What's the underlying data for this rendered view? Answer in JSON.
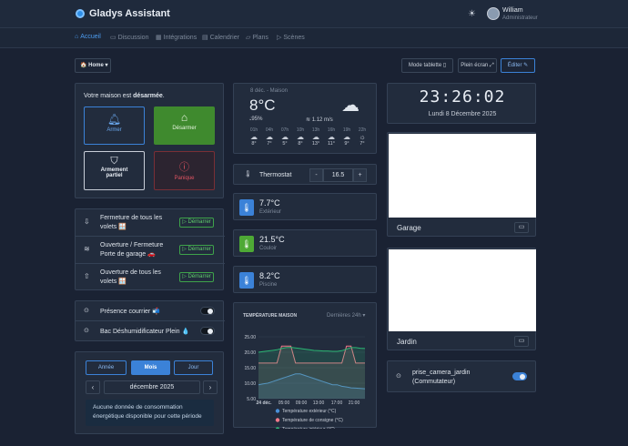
{
  "app": {
    "title": "Gladys Assistant"
  },
  "user": {
    "name": "William",
    "role": "Administrateur"
  },
  "nav": [
    {
      "icon": "home-icon",
      "label": "Accueil"
    },
    {
      "icon": "chat-icon",
      "label": "Discussion"
    },
    {
      "icon": "grid-icon",
      "label": "Intégrations"
    },
    {
      "icon": "calendar-icon",
      "label": "Calendrier"
    },
    {
      "icon": "map-icon",
      "label": "Plans"
    },
    {
      "icon": "play-icon",
      "label": "Scènes"
    }
  ],
  "toolbar": {
    "home_select": "Home",
    "tablet_mode": "Mode tablette",
    "fullscreen": "Plein écran",
    "edit": "Éditer"
  },
  "alarm": {
    "status_prefix": "Votre maison est",
    "status_value": "désarmée",
    "arm": "Armer",
    "disarm": "Désarmer",
    "partial_line1": "Armement",
    "partial_line2": "partiel",
    "panic": "Panique"
  },
  "scenes": [
    {
      "line1": "Fermeture de tous les",
      "line2": "volets 🪟",
      "button": "Démarrer"
    },
    {
      "line1": "Ouverture / Fermeture",
      "line2": "Porte de garage 🚗",
      "button": "Démarrer"
    },
    {
      "line1": "Ouverture de tous les",
      "line2": "volets 🪟",
      "button": "Démarrer"
    }
  ],
  "switches": [
    {
      "label": "Présence courrier 📬",
      "on": false
    },
    {
      "label": "Bac Déshumidificateur Plein 💧",
      "on": false
    }
  ],
  "energy": {
    "tabs": [
      "Année",
      "Mois",
      "Jour"
    ],
    "active_tab": "Mois",
    "period": "décembre 2025",
    "message": "Aucune donnée de consommation énergétique disponible pour cette période"
  },
  "weather": {
    "header": "8 déc. - Maison",
    "temp": "8°C",
    "humidity": "95%",
    "wind": "1.12 m/s",
    "hours": [
      "01h",
      "04h",
      "07h",
      "10h",
      "13h",
      "16h",
      "19h",
      "22h"
    ],
    "hour_temps": [
      "8°",
      "7°",
      "5°",
      "8°",
      "13°",
      "11°",
      "9°",
      "7°"
    ]
  },
  "thermostat": {
    "label": "Thermostat",
    "value": "16.5",
    "minus": "-",
    "plus": "+"
  },
  "sensors": [
    {
      "value": "7.7°C",
      "name": "Extérieur",
      "color": "#3b82d8"
    },
    {
      "value": "21.5°C",
      "name": "Couloir",
      "color": "#4ea935"
    },
    {
      "value": "8.2°C",
      "name": "Piscine",
      "color": "#3b82d8"
    }
  ],
  "chart_data": {
    "type": "line",
    "title": "TEMPÉRATURE MAISON",
    "range": "Dernières 24h",
    "x_ticks": [
      "24 déc.",
      "05:00",
      "09:00",
      "13:00",
      "17:00",
      "21:00"
    ],
    "y_ticks": [
      25,
      20,
      15,
      10,
      5
    ],
    "ylim": [
      5,
      25
    ],
    "series": [
      {
        "name": "Température extérieur (°C)",
        "color": "#4a90d9",
        "values": [
          9.5,
          9.8,
          10,
          10.5,
          11,
          11.5,
          12,
          12.5,
          13,
          13,
          12.5,
          12,
          11.5,
          11,
          10.5,
          10,
          9.5,
          9.5,
          9,
          8.8,
          8.5,
          8.4,
          8.3,
          8.2
        ]
      },
      {
        "name": "Température de consigne (°C)",
        "color": "#f07a8a",
        "values": [
          16.5,
          16.5,
          16.5,
          16.5,
          16.5,
          22,
          22,
          22,
          16.5,
          16.5,
          16.5,
          16.5,
          16.5,
          16.5,
          16.5,
          16.5,
          16.5,
          16.5,
          16.5,
          22,
          22,
          16.5,
          16.5,
          16.5
        ]
      },
      {
        "name": "Température intérieur (°C)",
        "color": "#2bb673",
        "values": [
          20,
          20.2,
          20.4,
          20.6,
          20.8,
          21.2,
          21.5,
          21.6,
          21.4,
          21.2,
          21,
          20.8,
          20.6,
          20.5,
          20.4,
          20.4,
          20.3,
          20.3,
          20.5,
          21,
          21.5,
          21.5,
          21.3,
          21.2
        ]
      }
    ]
  },
  "clock": {
    "time": "23:26:02",
    "date": "Lundi 8 Décembre 2025"
  },
  "cameras": [
    {
      "name": "Garage"
    },
    {
      "name": "Jardin"
    }
  ],
  "camera_switch": {
    "line1": "prise_camera_jardin",
    "line2": "(Commutateur)",
    "on": true
  }
}
